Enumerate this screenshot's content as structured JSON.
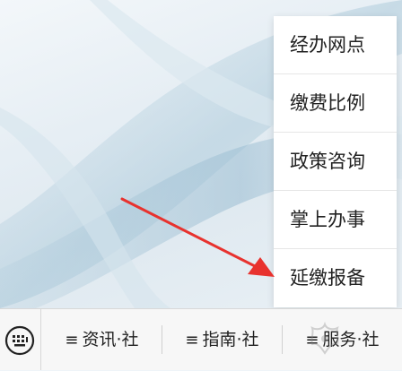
{
  "menu": {
    "items": [
      {
        "label": "经办网点"
      },
      {
        "label": "缴费比例"
      },
      {
        "label": "政策咨询"
      },
      {
        "label": "掌上办事"
      },
      {
        "label": "延缴报备"
      }
    ]
  },
  "bottom_bar": {
    "keyboard_icon": "keyboard-icon",
    "tabs": [
      {
        "icon": "≡",
        "label": "资讯·社"
      },
      {
        "icon": "≡",
        "label": "指南·社"
      },
      {
        "icon": "≡",
        "label": "服务·社"
      }
    ]
  },
  "annotation": {
    "color": "#e8322e"
  }
}
